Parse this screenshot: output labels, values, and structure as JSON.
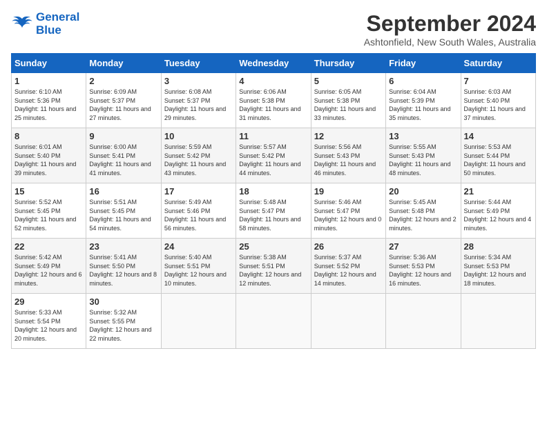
{
  "header": {
    "logo_line1": "General",
    "logo_line2": "Blue",
    "month_title": "September 2024",
    "location": "Ashtonfield, New South Wales, Australia"
  },
  "weekdays": [
    "Sunday",
    "Monday",
    "Tuesday",
    "Wednesday",
    "Thursday",
    "Friday",
    "Saturday"
  ],
  "weeks": [
    [
      {
        "day": "1",
        "sunrise": "6:10 AM",
        "sunset": "5:36 PM",
        "daylight": "11 hours and 25 minutes."
      },
      {
        "day": "2",
        "sunrise": "6:09 AM",
        "sunset": "5:37 PM",
        "daylight": "11 hours and 27 minutes."
      },
      {
        "day": "3",
        "sunrise": "6:08 AM",
        "sunset": "5:37 PM",
        "daylight": "11 hours and 29 minutes."
      },
      {
        "day": "4",
        "sunrise": "6:06 AM",
        "sunset": "5:38 PM",
        "daylight": "11 hours and 31 minutes."
      },
      {
        "day": "5",
        "sunrise": "6:05 AM",
        "sunset": "5:38 PM",
        "daylight": "11 hours and 33 minutes."
      },
      {
        "day": "6",
        "sunrise": "6:04 AM",
        "sunset": "5:39 PM",
        "daylight": "11 hours and 35 minutes."
      },
      {
        "day": "7",
        "sunrise": "6:03 AM",
        "sunset": "5:40 PM",
        "daylight": "11 hours and 37 minutes."
      }
    ],
    [
      {
        "day": "8",
        "sunrise": "6:01 AM",
        "sunset": "5:40 PM",
        "daylight": "11 hours and 39 minutes."
      },
      {
        "day": "9",
        "sunrise": "6:00 AM",
        "sunset": "5:41 PM",
        "daylight": "11 hours and 41 minutes."
      },
      {
        "day": "10",
        "sunrise": "5:59 AM",
        "sunset": "5:42 PM",
        "daylight": "11 hours and 43 minutes."
      },
      {
        "day": "11",
        "sunrise": "5:57 AM",
        "sunset": "5:42 PM",
        "daylight": "11 hours and 44 minutes."
      },
      {
        "day": "12",
        "sunrise": "5:56 AM",
        "sunset": "5:43 PM",
        "daylight": "11 hours and 46 minutes."
      },
      {
        "day": "13",
        "sunrise": "5:55 AM",
        "sunset": "5:43 PM",
        "daylight": "11 hours and 48 minutes."
      },
      {
        "day": "14",
        "sunrise": "5:53 AM",
        "sunset": "5:44 PM",
        "daylight": "11 hours and 50 minutes."
      }
    ],
    [
      {
        "day": "15",
        "sunrise": "5:52 AM",
        "sunset": "5:45 PM",
        "daylight": "11 hours and 52 minutes."
      },
      {
        "day": "16",
        "sunrise": "5:51 AM",
        "sunset": "5:45 PM",
        "daylight": "11 hours and 54 minutes."
      },
      {
        "day": "17",
        "sunrise": "5:49 AM",
        "sunset": "5:46 PM",
        "daylight": "11 hours and 56 minutes."
      },
      {
        "day": "18",
        "sunrise": "5:48 AM",
        "sunset": "5:47 PM",
        "daylight": "11 hours and 58 minutes."
      },
      {
        "day": "19",
        "sunrise": "5:46 AM",
        "sunset": "5:47 PM",
        "daylight": "12 hours and 0 minutes."
      },
      {
        "day": "20",
        "sunrise": "5:45 AM",
        "sunset": "5:48 PM",
        "daylight": "12 hours and 2 minutes."
      },
      {
        "day": "21",
        "sunrise": "5:44 AM",
        "sunset": "5:49 PM",
        "daylight": "12 hours and 4 minutes."
      }
    ],
    [
      {
        "day": "22",
        "sunrise": "5:42 AM",
        "sunset": "5:49 PM",
        "daylight": "12 hours and 6 minutes."
      },
      {
        "day": "23",
        "sunrise": "5:41 AM",
        "sunset": "5:50 PM",
        "daylight": "12 hours and 8 minutes."
      },
      {
        "day": "24",
        "sunrise": "5:40 AM",
        "sunset": "5:51 PM",
        "daylight": "12 hours and 10 minutes."
      },
      {
        "day": "25",
        "sunrise": "5:38 AM",
        "sunset": "5:51 PM",
        "daylight": "12 hours and 12 minutes."
      },
      {
        "day": "26",
        "sunrise": "5:37 AM",
        "sunset": "5:52 PM",
        "daylight": "12 hours and 14 minutes."
      },
      {
        "day": "27",
        "sunrise": "5:36 AM",
        "sunset": "5:53 PM",
        "daylight": "12 hours and 16 minutes."
      },
      {
        "day": "28",
        "sunrise": "5:34 AM",
        "sunset": "5:53 PM",
        "daylight": "12 hours and 18 minutes."
      }
    ],
    [
      {
        "day": "29",
        "sunrise": "5:33 AM",
        "sunset": "5:54 PM",
        "daylight": "12 hours and 20 minutes."
      },
      {
        "day": "30",
        "sunrise": "5:32 AM",
        "sunset": "5:55 PM",
        "daylight": "12 hours and 22 minutes."
      },
      null,
      null,
      null,
      null,
      null
    ]
  ]
}
